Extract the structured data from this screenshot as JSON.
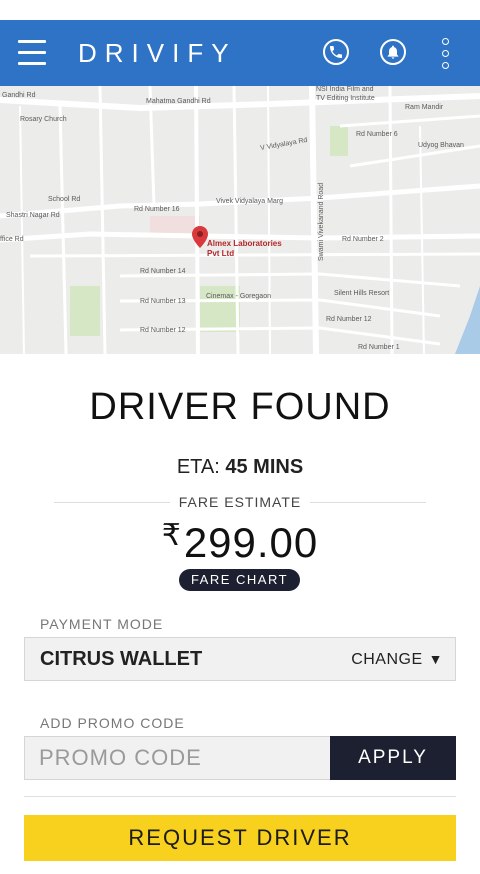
{
  "app": {
    "title": "DRIVIFY"
  },
  "colors": {
    "appbar": "#2f73c6",
    "dark": "#1d2030",
    "accent": "#f7d11e"
  },
  "header_icons": [
    "menu-icon",
    "phone-icon",
    "bell-icon",
    "more-vert-icon"
  ],
  "map": {
    "labels": {
      "gandhi": "Gandhi Rd",
      "mahatma": "Mahatma Gandhi Rd",
      "nsi": "NSI India Film and",
      "tv": "TV Editing Institute",
      "ram": "Ram Mandir",
      "rosary": "Rosary Church",
      "rdno6a": "Rd Number 6",
      "udyog": "Udyog Bhavan",
      "vidyalaya": "V Vidyalaya Rd",
      "school": "School Rd",
      "shastri": "Shastri Nagar Rd",
      "rd16": "Rd Number 16",
      "vivek": "Vivek Vidyalaya Marg",
      "office": "ffice Rd",
      "rd2": "Rd Number 2",
      "rd14": "Rd Number 14",
      "rd13": "Rd Number 13",
      "cinemax": "Cinemax - Goregaon",
      "silent": "Silent Hills Resort",
      "rd12a": "Rd Number 12",
      "rd12b": "Rd Number 12",
      "rd1": "Rd Number 1",
      "swami": "Swami Vivekanand Road",
      "almex1": "Almex Laboratories",
      "almex2": "Pvt Ltd"
    }
  },
  "status": {
    "title": "DRIVER FOUND",
    "eta_label": "ETA:",
    "eta_value": "45 MINS",
    "fare_label": "FARE ESTIMATE",
    "currency": "₹",
    "fare_value": "299.00",
    "fare_chart": "FARE CHART"
  },
  "payment": {
    "label": "PAYMENT MODE",
    "value": "CITRUS WALLET",
    "change": "CHANGE",
    "caret": "▼"
  },
  "promo": {
    "label": "ADD PROMO CODE",
    "placeholder": "PROMO CODE",
    "value": "",
    "apply": "APPLY"
  },
  "request": {
    "label": "REQUEST DRIVER"
  }
}
